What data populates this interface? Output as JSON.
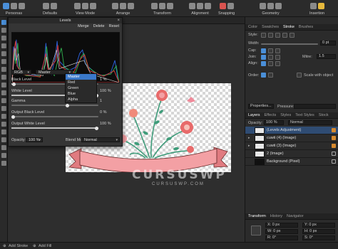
{
  "toolbar": {
    "items": [
      {
        "label": "Personas"
      },
      {
        "label": "Defaults"
      },
      {
        "label": "View Mode"
      },
      {
        "label": "Arrange"
      },
      {
        "label": "Transform"
      },
      {
        "label": "Alignment"
      },
      {
        "label": "Snapping"
      },
      {
        "label": "Geometry"
      },
      {
        "label": "Insertion"
      }
    ]
  },
  "levels": {
    "title": "Levels",
    "close": "×",
    "buttons": {
      "merge": "Merge",
      "delete": "Delete",
      "reset": "Reset"
    },
    "channel_value": "RGB",
    "target_value": "Master",
    "target_options": [
      "Master",
      "Red",
      "Green",
      "Blue",
      "Alpha"
    ],
    "black_level_label": "Black Level",
    "black_level_value": "1 %",
    "white_level_label": "White Level",
    "white_level_value": "100 %",
    "gamma_label": "Gamma",
    "gamma_value": "1",
    "output_black_label": "Output Black Level",
    "output_black_value": "0 %",
    "output_white_label": "Output White Level",
    "output_white_value": "100 %",
    "opacity_label": "Opacity:",
    "opacity_value": "100 %",
    "blend_label": "Blend Mode:",
    "blend_value": "Normal",
    "levels_fill": {
      "black": 0.01,
      "white": 1.0,
      "out_black": 0.0,
      "out_white": 1.0
    }
  },
  "right_panel": {
    "tabs_top": [
      "Color",
      "Swatches",
      "Stroke",
      "Brushes"
    ],
    "style_label": "Style:",
    "width_label": "Width:",
    "width_value": "0 pt",
    "cap_label": "Cap:",
    "join_label": "Join:",
    "align_label": "Align:",
    "mitre_label": "Mitre:",
    "mitre_value": "1.5",
    "order_label": "Order:",
    "scale_label": "Scale with object",
    "properties_label": "Properties...",
    "pressure_label": "Pressure:",
    "tabs_layers": [
      "Layers",
      "Effects",
      "Styles",
      "Text Styles",
      "Stock"
    ],
    "opacity_label": "Opacity:",
    "opacity_value": "100 %",
    "blend_value": "Normal",
    "layers": [
      {
        "name": "(Levels Adjustment)",
        "selected": true
      },
      {
        "name": "cuwti (4) (Image)",
        "selected": false
      },
      {
        "name": "cuwti (3) (Image)",
        "selected": false
      },
      {
        "name": "2 (Image)",
        "selected": false
      },
      {
        "name": "Background (Pixel)",
        "selected": false
      }
    ],
    "tabs_transform": [
      "Transform",
      "History",
      "Navigator"
    ],
    "transform_fields": [
      "X: 0 px",
      "Y: 0 px",
      "W: 0 px",
      "H: 0 px",
      "R: 0°",
      "S: 0°"
    ]
  },
  "watermark": {
    "big": "CURSUSWP",
    "small": "CURSUSWP.COM"
  },
  "status": {
    "add_stroke": "Add Stroke",
    "add_fill": "Add Fill"
  },
  "colors": {
    "accent": "#4a8fd8",
    "selection": "#2f4c73",
    "banner_pink": "#f3a0a4",
    "leaf_green": "#3f9c7a",
    "flower_red": "#e86a6a"
  }
}
